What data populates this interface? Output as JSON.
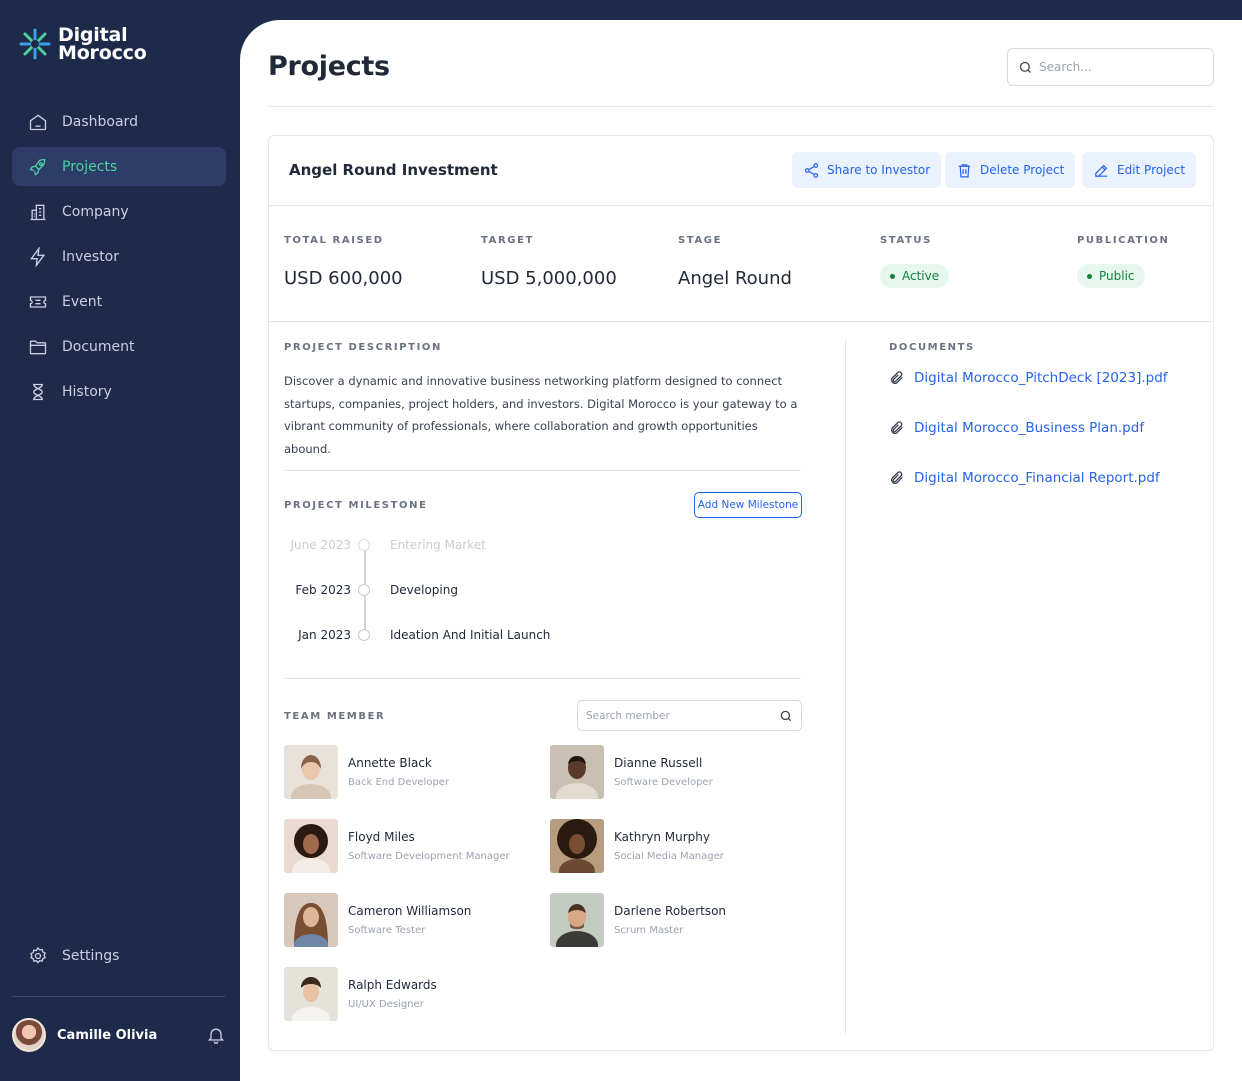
{
  "brand": {
    "line1": "Digital",
    "line2": "Morocco"
  },
  "sidebar": {
    "items": [
      {
        "label": "Dashboard",
        "icon": "home-icon"
      },
      {
        "label": "Projects",
        "icon": "rocket-icon"
      },
      {
        "label": "Company",
        "icon": "building-icon"
      },
      {
        "label": "Investor",
        "icon": "lightning-icon"
      },
      {
        "label": "Event",
        "icon": "ticket-icon"
      },
      {
        "label": "Document",
        "icon": "folder-icon"
      },
      {
        "label": "History",
        "icon": "hourglass-icon"
      }
    ],
    "settings_label": "Settings",
    "user_name": "Camille Olivia"
  },
  "header": {
    "title": "Projects",
    "search_placeholder": "Search..."
  },
  "project": {
    "name": "Angel Round Investment",
    "actions": {
      "share": "Share to Investor",
      "delete": "Delete Project",
      "edit": "Edit Project"
    },
    "stats": {
      "total_raised_label": "TOTAL RAISED",
      "total_raised_value": "USD 600,000",
      "target_label": "TARGET",
      "target_value": "USD 5,000,000",
      "stage_label": "STAGE",
      "stage_value": "Angel Round",
      "status_label": "STATUS",
      "status_value": "Active",
      "publication_label": "PUBLICATION",
      "publication_value": "Public"
    },
    "description_label": "PROJECT DESCRIPTION",
    "description": "Discover a dynamic and innovative business networking platform designed to connect startups, companies, project holders, and investors. Digital Morocco is your gateway to a vibrant community of professionals, where collaboration and growth opportunities abound.",
    "milestone_label": "PROJECT MILESTONE",
    "add_milestone": "Add New Milestone",
    "milestones": [
      {
        "date": "June 2023",
        "title": "Entering Market"
      },
      {
        "date": "Feb 2023",
        "title": "Developing"
      },
      {
        "date": "Jan 2023",
        "title": "Ideation And Initial Launch"
      }
    ],
    "team_label": "TEAM MEMBER",
    "member_search_placeholder": "Search member",
    "team": [
      {
        "name": "Annette Black",
        "role": "Back End Developer"
      },
      {
        "name": "Dianne Russell",
        "role": "Software Developer"
      },
      {
        "name": "Floyd Miles",
        "role": "Software Development Manager"
      },
      {
        "name": "Kathryn Murphy",
        "role": "Social Media Manager"
      },
      {
        "name": "Cameron Williamson",
        "role": "Software Tester"
      },
      {
        "name": "Darlene Robertson",
        "role": "Scrum Master"
      },
      {
        "name": "Ralph Edwards",
        "role": "UI/UX Designer"
      }
    ],
    "documents_label": "DOCUMENTS",
    "documents": [
      "Digital Morocco_PitchDeck [2023].pdf",
      "Digital Morocco_Business Plan.pdf",
      "Digital Morocco_Financial Report.pdf"
    ]
  },
  "colors": {
    "sidebar_bg": "#1e2a4a",
    "active_accent": "#4dd0a0",
    "link_blue": "#2563eb",
    "status_green": "#15803d"
  }
}
